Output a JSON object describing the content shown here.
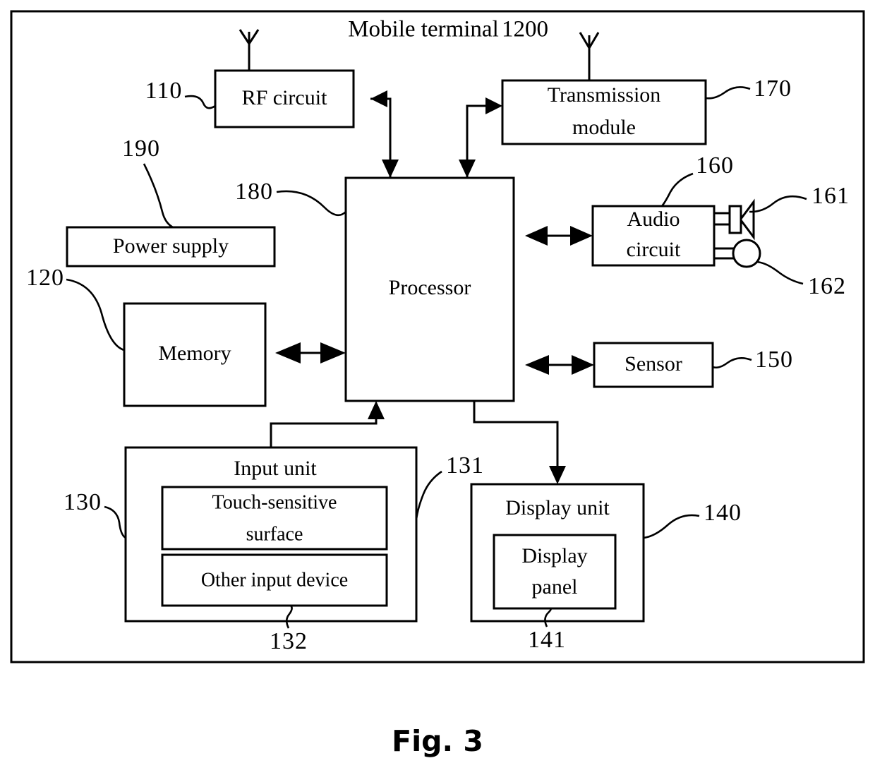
{
  "figure": {
    "caption": "Fig. 3",
    "title": "Mobile terminal",
    "title_ref": "1200"
  },
  "blocks": {
    "rf_circuit": {
      "label": "RF circuit",
      "ref": "110"
    },
    "transmission": {
      "label_line1": "Transmission",
      "label_line2": "module",
      "ref": "170"
    },
    "processor": {
      "label": "Processor",
      "ref": "180"
    },
    "power_supply": {
      "label": "Power supply",
      "ref": "190"
    },
    "memory": {
      "label": "Memory",
      "ref": "120"
    },
    "audio_circuit": {
      "label_line1": "Audio",
      "label_line2": "circuit",
      "ref": "160"
    },
    "speaker": {
      "ref": "161"
    },
    "microphone": {
      "ref": "162"
    },
    "sensor": {
      "label": "Sensor",
      "ref": "150"
    },
    "input_unit": {
      "label": "Input unit",
      "ref": "130"
    },
    "touch_surface": {
      "label_line1": "Touch-sensitive",
      "label_line2": "surface",
      "ref": "131"
    },
    "other_input": {
      "label": "Other input device",
      "ref": "132"
    },
    "display_unit": {
      "label": "Display unit",
      "ref": "140"
    },
    "display_panel": {
      "label_line1": "Display",
      "label_line2": "panel",
      "ref": "141"
    }
  },
  "colors": {
    "ink": "#000000",
    "paper": "#ffffff"
  }
}
